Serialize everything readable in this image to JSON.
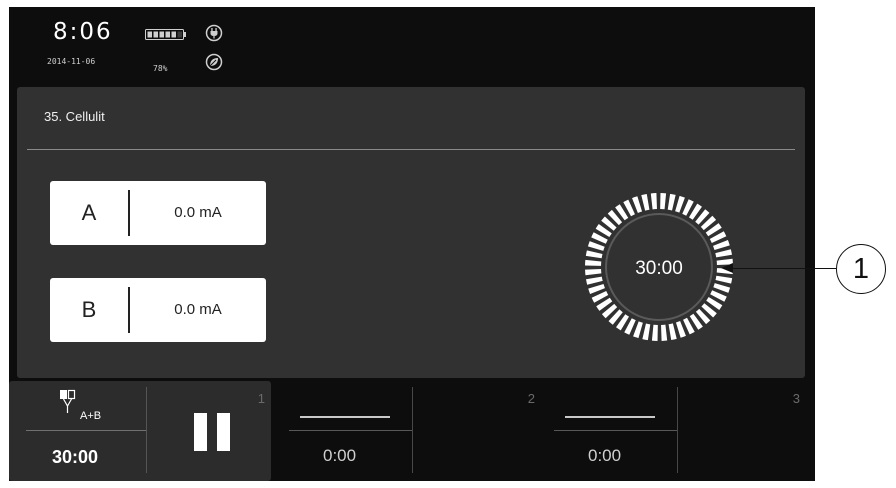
{
  "status_bar": {
    "time": "8:06",
    "date": "2014-11-06",
    "battery_percent": "78%",
    "battery_level": 0.78,
    "power_icon": "plug-icon",
    "eco_icon": "eco-leaf-icon"
  },
  "program": {
    "title": "35. Cellulit"
  },
  "channels": [
    {
      "letter": "A",
      "value": "0.0 mA"
    },
    {
      "letter": "B",
      "value": "0.0 mA"
    }
  ],
  "timer": {
    "value": "30:00"
  },
  "slots": [
    {
      "number": "1",
      "electrode_label": "A+B",
      "time": "30:00",
      "control_icon": "pause-icon"
    },
    {
      "number": "2",
      "dash": "—",
      "time": "0:00"
    },
    {
      "number": "3",
      "dash": "—",
      "time": "0:00"
    }
  ],
  "callout": {
    "label": "1"
  },
  "colors": {
    "screen_bg": "#0d0d0d",
    "panel_bg": "#313131",
    "text": "#ffffff"
  }
}
